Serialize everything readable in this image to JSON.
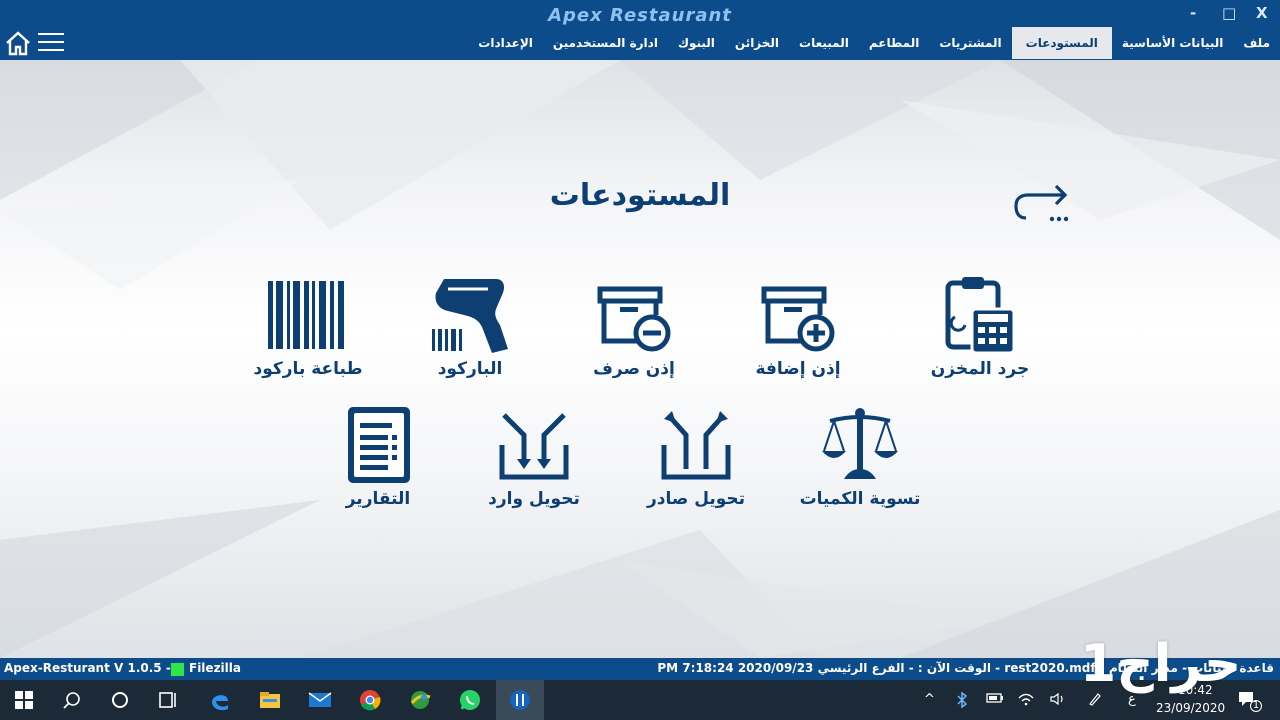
{
  "window": {
    "title": "Apex Restaurant",
    "controls": {
      "minimize": "-",
      "maximize": "□",
      "close": "X"
    }
  },
  "colors": {
    "primary": "#0d4c8b",
    "text_dark": "#0d3f73",
    "active_tab_bg": "#e6e8eb",
    "ftp_status": "#2ee64a"
  },
  "menu": {
    "tabs": [
      {
        "label": "ملف",
        "active": false
      },
      {
        "label": "البيانات الأساسية",
        "active": false
      },
      {
        "label": "المستودعات",
        "active": true
      },
      {
        "label": "المشتريات",
        "active": false
      },
      {
        "label": "المطاعم",
        "active": false
      },
      {
        "label": "المبيعات",
        "active": false
      },
      {
        "label": "الخزائن",
        "active": false
      },
      {
        "label": "البنوك",
        "active": false
      },
      {
        "label": "ادارة المستخدمين",
        "active": false
      },
      {
        "label": "الإعدادات",
        "active": false
      }
    ],
    "home_icon": "home-icon",
    "hamburger_icon": "hamburger-icon"
  },
  "page": {
    "title": "المستودعات",
    "back_icon": "redo-arrow-icon",
    "tiles_row1": [
      {
        "label": "جرد المخزن",
        "icon": "clipboard-calculator-icon"
      },
      {
        "label": "إذن إضافة",
        "icon": "box-plus-icon"
      },
      {
        "label": "إذن صرف",
        "icon": "box-minus-icon"
      },
      {
        "label": "الباركود",
        "icon": "barcode-scanner-icon"
      },
      {
        "label": "طباعة باركود",
        "icon": "barcode-icon"
      }
    ],
    "tiles_row2": [
      {
        "label": "تسوية الكميات",
        "icon": "scales-icon"
      },
      {
        "label": "تحويل صادر",
        "icon": "transfer-out-icon"
      },
      {
        "label": "تحويل وارد",
        "icon": "transfer-in-icon"
      },
      {
        "label": "التقارير",
        "icon": "report-document-icon"
      }
    ]
  },
  "status_bar": {
    "version": "Apex-Resturant V 1.0.5  -",
    "ftp_label": "Filezilla",
    "right_text": "PM 7:18:24 2020/09/23  الوقت الآن :  -  الفرع الرئيسي  -  rest2020.mdf  -  قاعدة البيانات  -  مدير النظام"
  },
  "taskbar": {
    "apps": [
      "windows-start-icon",
      "search-icon",
      "cortana-icon",
      "task-view-icon",
      "edge-icon",
      "file-explorer-icon",
      "mail-icon",
      "chrome-icon",
      "app-globe-icon",
      "whatsapp-icon",
      "restaurant-app-icon"
    ],
    "tray_keyboard": "ع",
    "clock_time": "10:42",
    "clock_date": "23/09/2020",
    "notifications": "1"
  },
  "watermark": "حراج1"
}
